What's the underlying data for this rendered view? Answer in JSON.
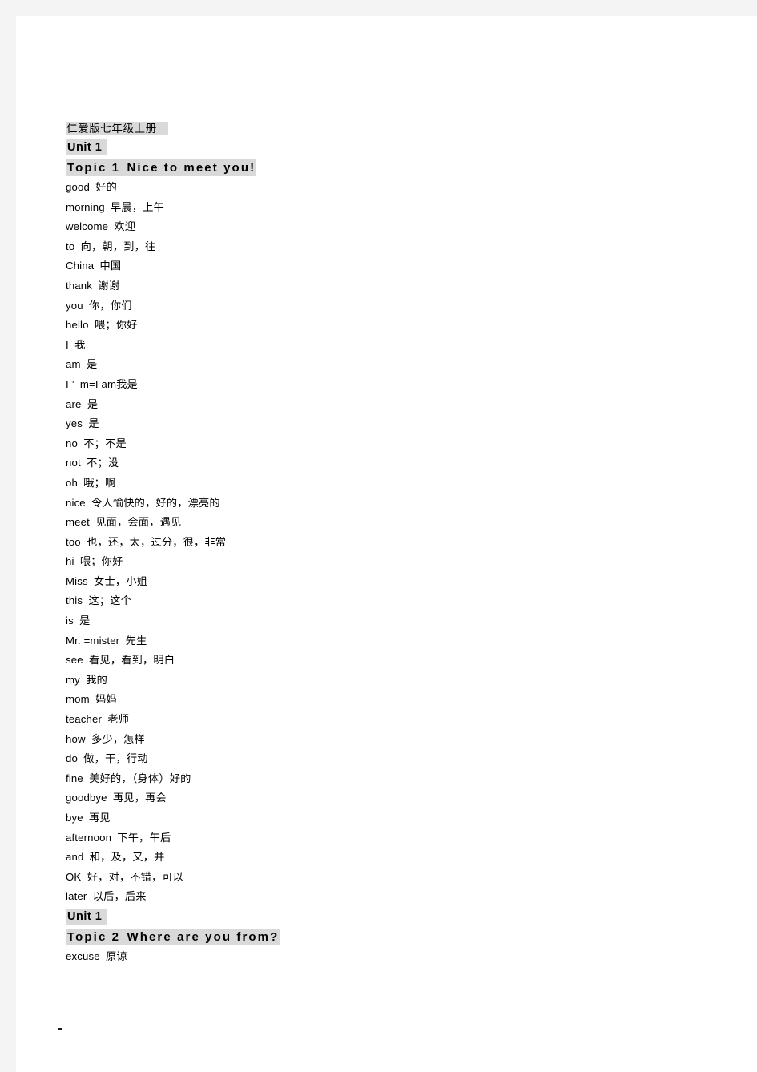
{
  "document": {
    "book_title": "仁爱版七年级上册",
    "sections": [
      {
        "unit": "Unit 1",
        "topic": "Topic 1",
        "topic_title": "Nice to meet you!",
        "entries": [
          {
            "word": "good",
            "gloss": "好的"
          },
          {
            "word": "morning",
            "gloss": "早晨，上午"
          },
          {
            "word": "welcome",
            "gloss": "欢迎"
          },
          {
            "word": "to",
            "gloss": "向，朝，到，往"
          },
          {
            "word": "China",
            "gloss": "中国"
          },
          {
            "word": "thank",
            "gloss": "谢谢"
          },
          {
            "word": "you",
            "gloss": "你，你们"
          },
          {
            "word": "hello",
            "gloss": "喂；你好"
          },
          {
            "word": "I",
            "gloss": "我"
          },
          {
            "word": "am",
            "gloss": "是"
          },
          {
            "word": "I ’  m=I am",
            "gloss": "我是"
          },
          {
            "word": "are",
            "gloss": "是"
          },
          {
            "word": "yes",
            "gloss": "是"
          },
          {
            "word": "no",
            "gloss": "不；不是"
          },
          {
            "word": "not",
            "gloss": "不；没"
          },
          {
            "word": "oh",
            "gloss": "哦；啊"
          },
          {
            "word": "nice",
            "gloss": "令人愉快的，好的，漂亮的"
          },
          {
            "word": "meet",
            "gloss": "见面，会面，遇见"
          },
          {
            "word": "too",
            "gloss": "也，还，太，过分，很，非常"
          },
          {
            "word": "hi",
            "gloss": "喂；你好"
          },
          {
            "word": "Miss",
            "gloss": "女士，小姐"
          },
          {
            "word": "this",
            "gloss": "这；这个"
          },
          {
            "word": "is",
            "gloss": "是"
          },
          {
            "word": "Mr. =mister",
            "gloss": "先生"
          },
          {
            "word": "see",
            "gloss": "看见，看到，明白"
          },
          {
            "word": "my",
            "gloss": "我的"
          },
          {
            "word": "mom",
            "gloss": "妈妈"
          },
          {
            "word": "teacher",
            "gloss": "老师"
          },
          {
            "word": "how",
            "gloss": "多少，怎样"
          },
          {
            "word": "do",
            "gloss": "做，干，行动"
          },
          {
            "word": "fine",
            "gloss": "美好的，（身体）好的"
          },
          {
            "word": "goodbye",
            "gloss": "再见，再会"
          },
          {
            "word": "bye",
            "gloss": "再见"
          },
          {
            "word": "afternoon",
            "gloss": "下午，午后"
          },
          {
            "word": "and",
            "gloss": "和，及，又，并"
          },
          {
            "word": "OK",
            "gloss": "好，对，不错，可以"
          },
          {
            "word": "later",
            "gloss": "以后，后来"
          }
        ]
      },
      {
        "unit": "Unit 1",
        "topic": "Topic 2",
        "topic_title": "Where are you from?",
        "entries": [
          {
            "word": "excuse",
            "gloss": "原谅"
          }
        ]
      }
    ]
  },
  "colors": {
    "page_background": "#ffffff",
    "canvas_background": "#f4f4f4",
    "highlight": "#d9d9d9",
    "text": "#000000"
  }
}
